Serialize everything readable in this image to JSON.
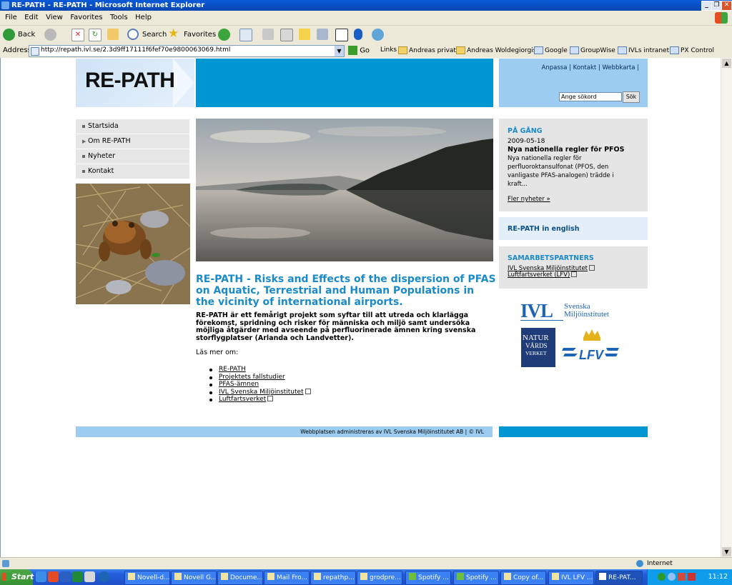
{
  "window": {
    "title": "RE-PATH - RE-PATH - Microsoft Internet Explorer",
    "controls": [
      "_",
      "❐",
      "✕"
    ]
  },
  "menu": [
    "File",
    "Edit",
    "View",
    "Favorites",
    "Tools",
    "Help"
  ],
  "toolbar": {
    "back": "Back",
    "search": "Search",
    "favorites": "Favorites"
  },
  "address": {
    "label": "Address",
    "url": "http://repath.ivl.se/2.3d9ff17111f6fef70e9800063069.html",
    "go": "Go"
  },
  "links": {
    "label": "Links",
    "items": [
      "Andreas privat",
      "Andreas Woldegiorgis",
      "Google",
      "GroupWise",
      "IVLs intranet",
      "PX Control"
    ]
  },
  "site": {
    "logo": "RE-PATH",
    "top_links": "Anpassa | Kontakt | Webbkarta |",
    "search_placeholder": "Ange sökord",
    "search_button": "Sök",
    "nav": [
      "Startsida",
      "Om RE-PATH",
      "Nyheter",
      "Kontakt"
    ],
    "heading": "RE-PATH - Risks and Effects of the dispersion of PFAS on Aquatic, Terrestrial and Human Populations in the vicinity of international airports.",
    "intro": "RE-PATH är ett femårigt projekt som syftar till att utreda och klarlägga förekomst, spridning och risker för människa och miljö samt undersöka möjliga åtgärder med avseende på perfluorinerade ämnen kring svenska storflygplatser (Arlanda och Landvetter).",
    "read_more": "Läs mer om:",
    "read_more_links": [
      "RE-PATH",
      "Projektets fallstudier",
      "PFAS-ämnen",
      "IVL Svenska Miljöinstitutet",
      "Luftfartsverket"
    ],
    "news": {
      "heading": "PÅ GÅNG",
      "date": "2009-05-18",
      "title": "Nya nationella regler för PFOS",
      "body": "Nya nationella regler för perfluoroktansulfonat (PFOS, den vanligaste PFAS-analogen) trädde i kraft...",
      "more": "Fler nyheter »"
    },
    "english": "RE-PATH in english",
    "partners": {
      "heading": "SAMARBETSPARTNERS",
      "items": [
        "IVL Svenska Miljöinstitutet",
        "Luftfartsverket (LFV)"
      ]
    },
    "footer": "Webbplatsen administreras av IVL Svenska Miljöinstitutet AB | © IVL"
  },
  "logos": {
    "ivl": "IVL",
    "ivl_line1": "Svenska",
    "ivl_line2": "Miljöinstitutet",
    "natur1": "NATUR",
    "natur2": "VÅRDS",
    "natur3": "VERKET",
    "lfv": "LFV"
  },
  "status": {
    "zone": "Internet"
  },
  "taskbar": {
    "start": "Start",
    "tasks": [
      "Novell-d...",
      "Novell G...",
      "Docume...",
      "Mail Fro...",
      "repathp...",
      "grodpre...",
      "Spotify ...",
      "Spotify ...",
      "Copy of...",
      "IVL LFV ...",
      "RE-PAT..."
    ],
    "clock": "11:12"
  },
  "colors": {
    "brand_blue": "#0096d1",
    "light_blue": "#9ccdf1",
    "heading_blue": "#1a8ac9"
  }
}
